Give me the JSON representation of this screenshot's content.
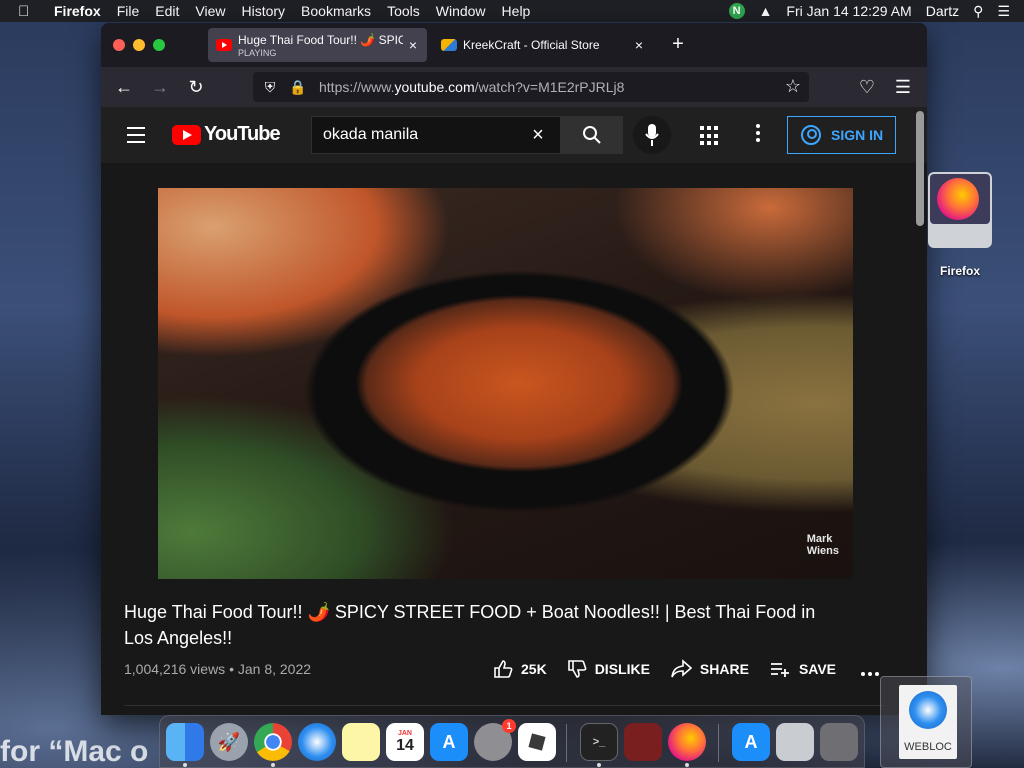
{
  "menubar": {
    "app": "Firefox",
    "items": [
      "File",
      "Edit",
      "View",
      "History",
      "Bookmarks",
      "Tools",
      "Window",
      "Help"
    ],
    "badge": "N",
    "clock": "Fri Jan 14  12:29 AM",
    "user": "Dartz"
  },
  "tabs": [
    {
      "title": "Huge Thai Food Tour!! 🌶️ SPICY",
      "sub": "PLAYING",
      "close": "×"
    },
    {
      "title": "KreekCraft - Official Store",
      "close": "×"
    }
  ],
  "newtab": "+",
  "nav": {
    "url_prefix": "https://www.",
    "url_domain": "youtube.com",
    "url_path": "/watch?v=M1E2rPJRLj8"
  },
  "youtube": {
    "logo": "YouTube",
    "search_value": "okada manila",
    "clear": "×",
    "sign_in": "SIGN IN",
    "watermark_line1": "Mark",
    "watermark_line2": "Wiens",
    "title": "Huge Thai Food Tour!! 🌶️ SPICY STREET FOOD + Boat Noodles!! | Best Thai Food in Los Angeles!!",
    "meta": "1,004,216 views • Jan 8, 2022",
    "likes": "25K",
    "dislike": "DISLIKE",
    "share": "SHARE",
    "save": "SAVE"
  },
  "desktop": {
    "icon_label": "Firefox",
    "bottom_text": "for “Mac o",
    "webloc_label": "WEBLOC"
  },
  "dock": {
    "calendar_month": "JAN",
    "calendar_day": "14",
    "badge": "1"
  },
  "colors": {
    "accent": "#3ea6ff",
    "youtube_red": "#ff0000",
    "page_bg": "#181818"
  }
}
